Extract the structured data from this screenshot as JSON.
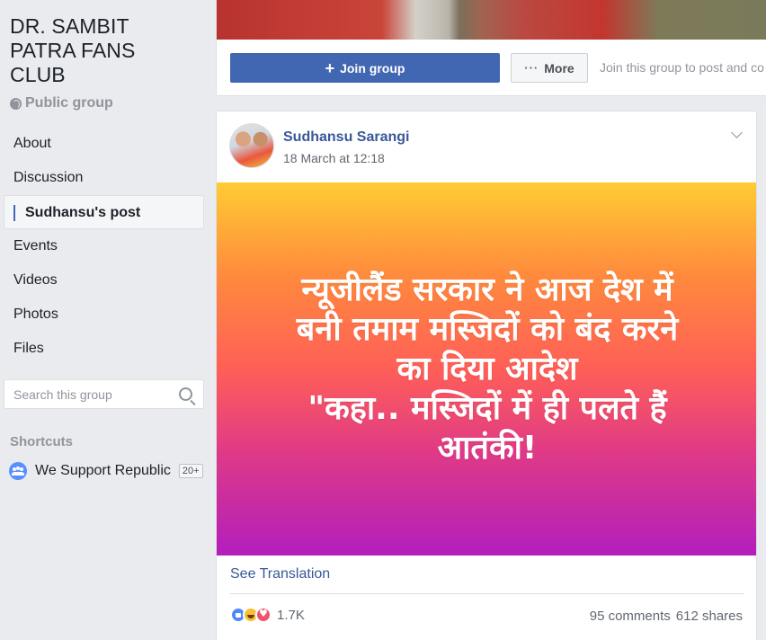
{
  "sidebar": {
    "title_lines": [
      "DR. SAMBIT",
      "PATRA FANS",
      "CLUB"
    ],
    "privacy": "Public group",
    "nav": [
      "About",
      "Discussion",
      "Sudhansu's post",
      "Events",
      "Videos",
      "Photos",
      "Files"
    ],
    "search_placeholder": "Search this group",
    "shortcuts_heading": "Shortcuts",
    "shortcut_label": "We Support Republic",
    "shortcut_badge": "20+"
  },
  "group_actions": {
    "join_label": "Join group",
    "more_label": "More",
    "hint": "Join this group to post and co"
  },
  "post": {
    "author": "Sudhansu Sarangi",
    "timestamp": "18 March at 12:18",
    "text_lines": [
      "न्यूजीलैंड सरकार ने आज देश में",
      "बनी तमाम मस्जिदों को बंद करने",
      "का दिया आदेश",
      "\"कहा.. मस्जिदों में ही पलते हैं",
      "आतंकी!"
    ],
    "see_translation": "See Translation",
    "reaction_count": "1.7K",
    "comments": "95 comments",
    "shares": "612 shares"
  },
  "colors": {
    "accent": "#4267b2",
    "link": "#385898",
    "background": "#e9ebee"
  },
  "icons": [
    "globe-icon",
    "search-icon",
    "group-icon",
    "plus-icon",
    "more-dots-icon",
    "chevron-down-icon",
    "like-icon",
    "haha-icon",
    "love-icon"
  ]
}
